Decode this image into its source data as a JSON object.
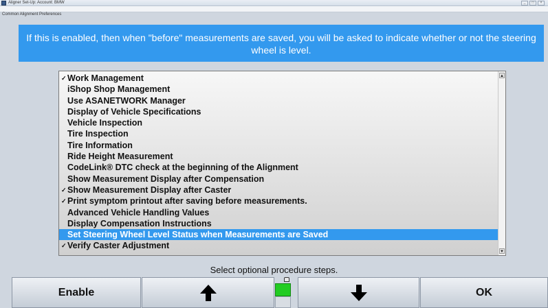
{
  "window": {
    "title": "Aligner Set-Up: Account: BMW",
    "subtitle": "Common Alignment Preferences"
  },
  "banner": {
    "text": "If this is enabled, then when \"before\" measurements are saved, you will be asked to indicate whether or not the steering wheel is level."
  },
  "list": {
    "items": [
      {
        "label": "Work Management",
        "checked": true,
        "selected": false
      },
      {
        "label": "iShop Shop Management",
        "checked": false,
        "selected": false
      },
      {
        "label": "Use ASANETWORK Manager",
        "checked": false,
        "selected": false
      },
      {
        "label": "Display of Vehicle Specifications",
        "checked": false,
        "selected": false
      },
      {
        "label": "Vehicle Inspection",
        "checked": false,
        "selected": false
      },
      {
        "label": "Tire Inspection",
        "checked": false,
        "selected": false
      },
      {
        "label": "Tire Information",
        "checked": false,
        "selected": false
      },
      {
        "label": "Ride Height Measurement",
        "checked": false,
        "selected": false
      },
      {
        "label": "CodeLink® DTC check at the beginning of the Alignment",
        "checked": false,
        "selected": false
      },
      {
        "label": "Show Measurement Display after Compensation",
        "checked": false,
        "selected": false
      },
      {
        "label": "Show Measurement Display after Caster",
        "checked": true,
        "selected": false
      },
      {
        "label": "Print symptom printout after saving before measurements.",
        "checked": true,
        "selected": false
      },
      {
        "label": "Advanced Vehicle Handling Values",
        "checked": false,
        "selected": false
      },
      {
        "label": "Display Compensation Instructions",
        "checked": false,
        "selected": false
      },
      {
        "label": "Set Steering Wheel Level Status when Measurements are Saved",
        "checked": false,
        "selected": true
      },
      {
        "label": "Verify Caster Adjustment",
        "checked": true,
        "selected": false
      }
    ],
    "check_glyph": "✓"
  },
  "status": {
    "text": "Select optional procedure steps."
  },
  "toolbar": {
    "enable_label": "Enable",
    "up_icon": "arrow-up-icon",
    "down_icon": "arrow-down-icon",
    "ok_label": "OK",
    "indicator_color": "#22cc22"
  },
  "colors": {
    "accent": "#3399ee",
    "background": "#cfd6df"
  }
}
